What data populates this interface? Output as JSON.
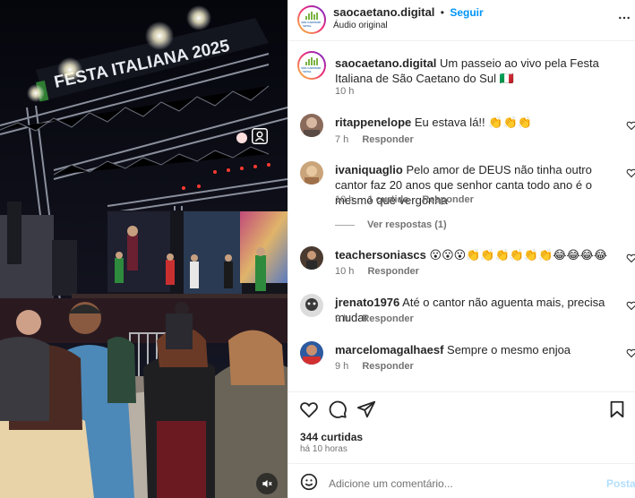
{
  "post": {
    "username": "saocaetano.digital",
    "follow_label": "Seguir",
    "separator": "•",
    "audio_label": "Áudio original",
    "more_icon": "more-horizontal-icon",
    "logo_text": "SÃO CAETANO DIGITAL",
    "caption_text": "Um passeio ao vivo pela Festa Italiana de São Caetano do Sul 🇮🇹",
    "caption_time": "10 h",
    "stage_banner": "FESTA ITALIANA 2025",
    "likes": "344 curtidas",
    "posted_ago": "há 10 horas",
    "comment_placeholder": "Adicione um comentário...",
    "post_label": "Postar"
  },
  "comments": [
    {
      "user": "ritappenelope",
      "text": "Eu estava lá!! 👏👏👏",
      "time": "7 h",
      "likes": "",
      "reply_label": "Responder"
    },
    {
      "user": "ivaniquaglio",
      "text": "Pelo amor de DEUS não tinha outro cantor faz 20 anos que senhor canta todo ano é o mesmo que vergonha",
      "time": "10 h",
      "likes": "1 curtida",
      "reply_label": "Responder",
      "view_replies": "Ver respostas (1)"
    },
    {
      "user": "teachersoniascs",
      "text": "😮😮😮👏👏👏👏👏👏😂😂😂😂",
      "time": "10 h",
      "likes": "",
      "reply_label": "Responder"
    },
    {
      "user": "jrenato1976",
      "text": "Até o cantor não aguenta mais, precisa mudar",
      "time": "9 h",
      "likes": "",
      "reply_label": "Responder"
    },
    {
      "user": "marcelomagalhaesf",
      "text": "Sempre o mesmo enjoa",
      "time": "9 h",
      "likes": "",
      "reply_label": "Responder"
    }
  ],
  "colors": {
    "accent": "#0095f6",
    "muted": "#737373",
    "post_disabled": "#b2dffc",
    "stage_green": "#2e7d32"
  }
}
